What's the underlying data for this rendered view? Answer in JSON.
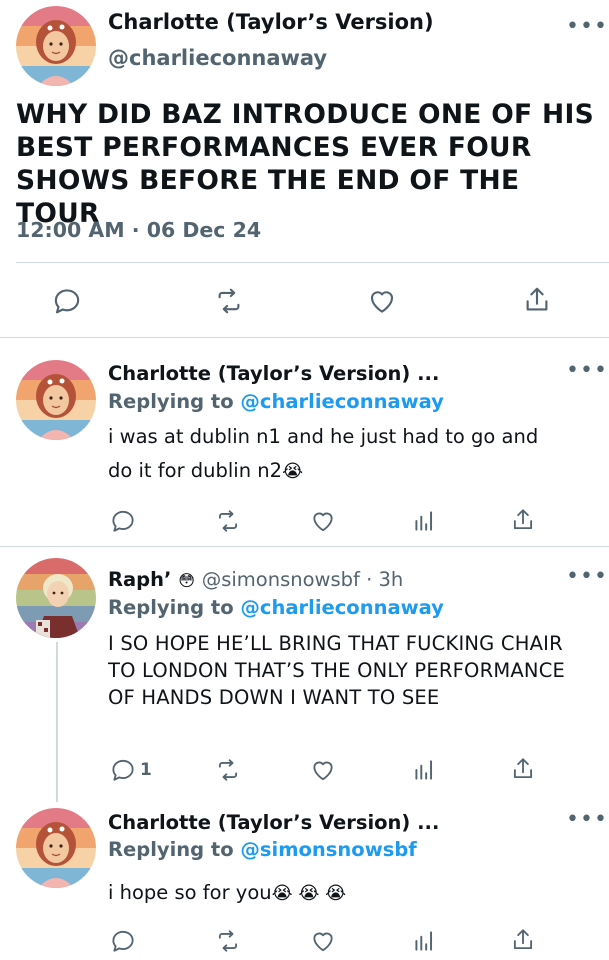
{
  "main_tweet": {
    "name": "Charlotte (Taylor’s Version)",
    "handle": "@charlieconnaway",
    "text": "WHY DID BAZ INTRODUCE ONE OF HIS BEST PERFORMANCES EVER FOUR SHOWS BEFORE THE END OF THE TOUR",
    "timestamp": "12:00 AM · 06 Dec 24",
    "actions": [
      "reply-icon",
      "retweet-icon",
      "like-icon",
      "share-icon"
    ]
  },
  "replies": [
    {
      "name": "Charlotte (Taylor’s Version) ...",
      "replying_prefix": "Replying to ",
      "replying_to": "@charlieconnaway",
      "text_line1": "i was at dublin n1 and he just had to go and",
      "text_line2": "do it for dublin n2",
      "emoji": "😭"
    },
    {
      "name": "Raph’",
      "name_emoji": "😳",
      "handle": "@simonsnowsbf · 3h",
      "replying_prefix": "Replying to ",
      "replying_to": "@charlieconnaway",
      "text": "I SO HOPE HE’LL BRING THAT FUCKING CHAIR TO LONDON THAT’S THE ONLY PERFORMANCE OF HANDS DOWN I WANT TO SEE",
      "reply_count": "1"
    },
    {
      "name": "Charlotte (Taylor’s Version) ...",
      "replying_prefix": "Replying to ",
      "replying_to": "@simonsnowsbf",
      "text": "i hope so for you",
      "emoji": "😭 😭 😭"
    }
  ],
  "colors": {
    "accent": "#1d9bf0",
    "secondary_text": "#536471",
    "divider": "#cfd9de"
  },
  "more_label": "•••"
}
